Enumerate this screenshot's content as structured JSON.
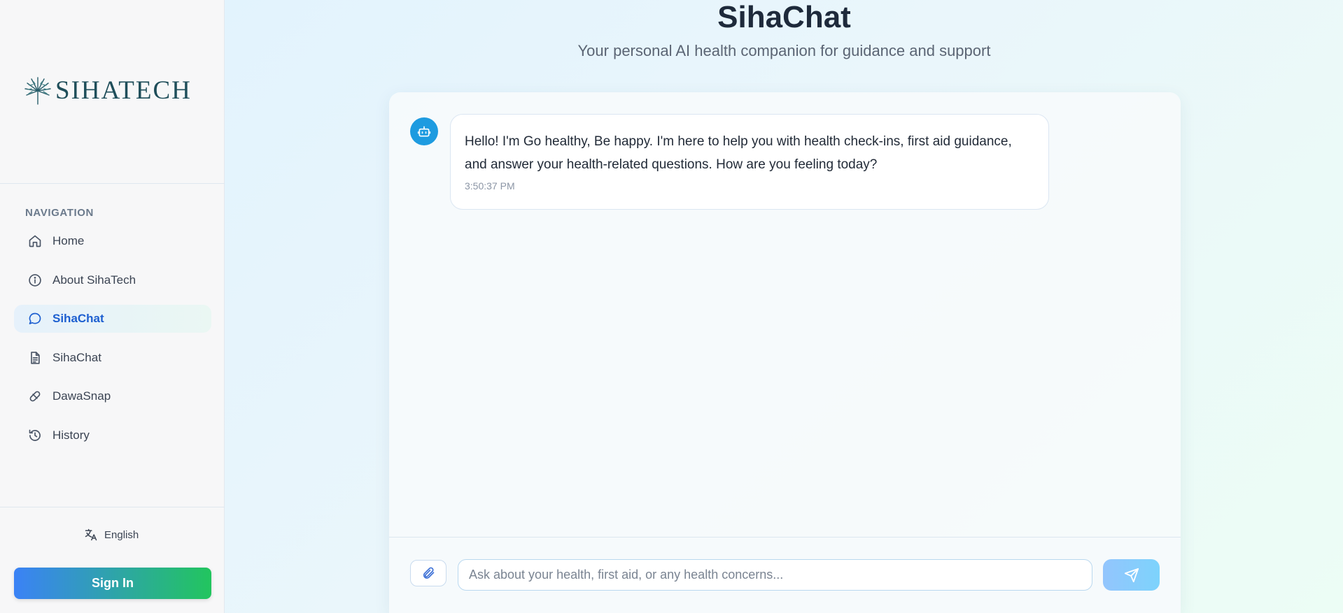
{
  "brand": {
    "name": "SIHATECH"
  },
  "sidebar": {
    "heading": "NAVIGATION",
    "items": [
      {
        "label": "Home",
        "icon": "home-icon"
      },
      {
        "label": "About SihaTech",
        "icon": "info-icon"
      },
      {
        "label": "SihaChat",
        "icon": "chat-bubble-icon",
        "active": true
      },
      {
        "label": "SihaChat",
        "icon": "document-icon"
      },
      {
        "label": "DawaSnap",
        "icon": "pill-icon"
      },
      {
        "label": "History",
        "icon": "history-icon"
      }
    ],
    "language": "English",
    "signin_label": "Sign In"
  },
  "header": {
    "title": "SihaChat",
    "subtitle": "Your personal AI health companion for guidance and support"
  },
  "chat": {
    "messages": [
      {
        "sender": "bot",
        "text": "Hello! I'm Go healthy, Be happy. I'm here to help you with health check-ins, first aid guidance, and answer your health-related questions. How are you feeling today?",
        "time": "3:50:37 PM"
      }
    ],
    "input_placeholder": "Ask about your health, first aid, or any health concerns...",
    "input_value": ""
  },
  "colors": {
    "accent_blue": "#1d5fd0",
    "bot_avatar": "#1e9be0",
    "signin_gradient_start": "#3b82f6",
    "signin_gradient_end": "#22c55e"
  }
}
